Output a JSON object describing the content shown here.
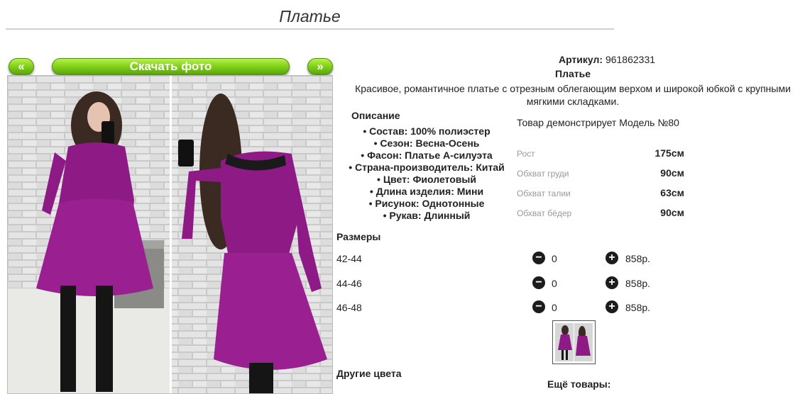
{
  "page": {
    "title": "Платье"
  },
  "gallery": {
    "prev_label": "«",
    "download_label": "Скачать фото",
    "next_label": "»"
  },
  "product": {
    "article_label": "Артикул:",
    "article_value": "961862331",
    "name": "Платье",
    "description": "Красивое, романтичное платье с отрезным облегающим верхом и широкой юбкой с крупными мягкими складками.",
    "spec_heading": "Описание",
    "specs": [
      "Состав: 100% полиэстер",
      "Сезон: Весна-Осень",
      "Фасон: Платье А-силуэта",
      "Страна-производитель: Китай",
      "Цвет: Фиолетовый",
      "Длина изделия: Мини",
      "Рисунок: Однотонные",
      "Рукав: Длинный"
    ]
  },
  "model": {
    "caption": "Товар демонстрирует Модель №80",
    "measurements": [
      {
        "label": "Рост",
        "value": "175см"
      },
      {
        "label": "Обхват груди",
        "value": "90см"
      },
      {
        "label": "Обхват талии",
        "value": "63см"
      },
      {
        "label": "Обхват бёдер",
        "value": "90см"
      }
    ]
  },
  "sizes": {
    "heading": "Размеры",
    "rows": [
      {
        "size": "42-44",
        "qty": "0",
        "price": "858р."
      },
      {
        "size": "44-46",
        "qty": "0",
        "price": "858р."
      },
      {
        "size": "46-48",
        "qty": "0",
        "price": "858р."
      }
    ]
  },
  "sections": {
    "other_colors": "Другие цвета",
    "more_goods": "Ещё товары:"
  },
  "icons": {
    "decrease": "minus-circle-icon",
    "increase": "plus-circle-icon"
  },
  "colors": {
    "accent_green": "#7ccd1a",
    "dress": "#8e1a86"
  }
}
